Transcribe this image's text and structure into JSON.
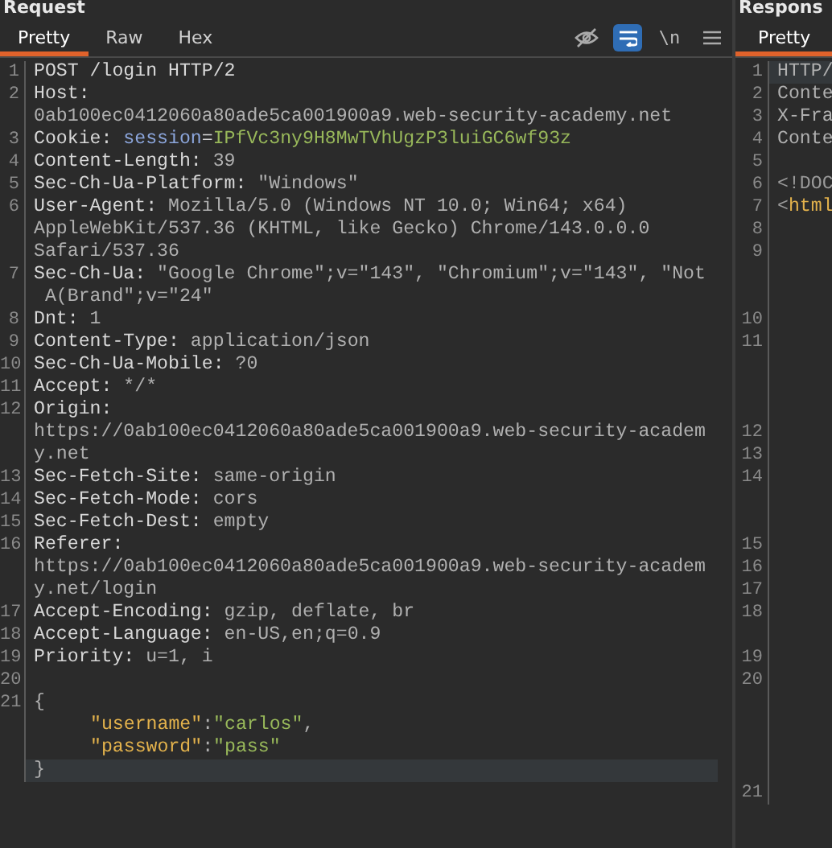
{
  "request": {
    "title": "Request",
    "tabs": [
      {
        "label": "Pretty",
        "selected": true
      },
      {
        "label": "Raw",
        "selected": false
      },
      {
        "label": "Hex",
        "selected": false
      }
    ],
    "toolbar": [
      {
        "kind": "hide",
        "on": false
      },
      {
        "kind": "wrap",
        "on": true
      },
      {
        "kind": "newline",
        "label": "\\n",
        "on": false
      },
      {
        "kind": "menu",
        "on": false
      }
    ],
    "rows": [
      {
        "number": "1",
        "highlighted": false,
        "segments": [
          {
            "text": "POST /login HTTP/2",
            "kind": "name"
          }
        ]
      },
      {
        "number": "2",
        "highlighted": false,
        "segments": [
          {
            "text": "Host:",
            "kind": "name"
          }
        ]
      },
      {
        "highlighted": false,
        "segments": [
          {
            "text": "0ab100ec0412060a80ade5ca001900a9.web-security-academy.net",
            "kind": "value"
          }
        ]
      },
      {
        "number": "3",
        "highlighted": false,
        "segments": [
          {
            "text": "Cookie: ",
            "kind": "name"
          },
          {
            "text": "session",
            "kind": "cookie"
          },
          {
            "text": "=",
            "kind": "name"
          },
          {
            "text": "IPfVc3ny9H8MwTVhUgzP3luiGC6wf93z",
            "kind": "token"
          }
        ]
      },
      {
        "number": "4",
        "highlighted": false,
        "segments": [
          {
            "text": "Content-Length:",
            "kind": "name"
          },
          {
            "text": " 39",
            "kind": "value"
          }
        ]
      },
      {
        "number": "5",
        "highlighted": false,
        "segments": [
          {
            "text": "Sec-Ch-Ua-Platform:",
            "kind": "name"
          },
          {
            "text": " \"Windows\"",
            "kind": "value"
          }
        ]
      },
      {
        "number": "6",
        "highlighted": false,
        "segments": [
          {
            "text": "User-Agent:",
            "kind": "name"
          },
          {
            "text": " Mozilla/5.0 (Windows NT 10.0; Win64; x64)",
            "kind": "value"
          }
        ]
      },
      {
        "highlighted": false,
        "segments": [
          {
            "text": "AppleWebKit/537.36 (KHTML, like Gecko) Chrome/143.0.0.0",
            "kind": "value"
          }
        ]
      },
      {
        "highlighted": false,
        "segments": [
          {
            "text": "Safari/537.36",
            "kind": "value"
          }
        ]
      },
      {
        "number": "7",
        "highlighted": false,
        "segments": [
          {
            "text": "Sec-Ch-Ua:",
            "kind": "name"
          },
          {
            "text": " \"Google Chrome\";v=\"143\", \"Chromium\";v=\"143\", \"Not",
            "kind": "value"
          }
        ]
      },
      {
        "highlighted": false,
        "segments": [
          {
            "text": " A(Brand\";v=\"24\"",
            "kind": "value"
          }
        ]
      },
      {
        "number": "8",
        "highlighted": false,
        "segments": [
          {
            "text": "Dnt:",
            "kind": "name"
          },
          {
            "text": " 1",
            "kind": "value"
          }
        ]
      },
      {
        "number": "9",
        "highlighted": false,
        "segments": [
          {
            "text": "Content-Type:",
            "kind": "name"
          },
          {
            "text": " application/json",
            "kind": "value"
          }
        ]
      },
      {
        "number": "10",
        "highlighted": false,
        "segments": [
          {
            "text": "Sec-Ch-Ua-Mobile:",
            "kind": "name"
          },
          {
            "text": " ?0",
            "kind": "value"
          }
        ]
      },
      {
        "number": "11",
        "highlighted": false,
        "segments": [
          {
            "text": "Accept:",
            "kind": "name"
          },
          {
            "text": " */*",
            "kind": "value"
          }
        ]
      },
      {
        "number": "12",
        "highlighted": false,
        "segments": [
          {
            "text": "Origin:",
            "kind": "name"
          }
        ]
      },
      {
        "highlighted": false,
        "segments": [
          {
            "text": "https://0ab100ec0412060a80ade5ca001900a9.web-security-academ",
            "kind": "value"
          }
        ]
      },
      {
        "highlighted": false,
        "segments": [
          {
            "text": "y.net",
            "kind": "value"
          }
        ]
      },
      {
        "number": "13",
        "highlighted": false,
        "segments": [
          {
            "text": "Sec-Fetch-Site:",
            "kind": "name"
          },
          {
            "text": " same-origin",
            "kind": "value"
          }
        ]
      },
      {
        "number": "14",
        "highlighted": false,
        "segments": [
          {
            "text": "Sec-Fetch-Mode:",
            "kind": "name"
          },
          {
            "text": " cors",
            "kind": "value"
          }
        ]
      },
      {
        "number": "15",
        "highlighted": false,
        "segments": [
          {
            "text": "Sec-Fetch-Dest:",
            "kind": "name"
          },
          {
            "text": " empty",
            "kind": "value"
          }
        ]
      },
      {
        "number": "16",
        "highlighted": false,
        "segments": [
          {
            "text": "Referer:",
            "kind": "name"
          }
        ]
      },
      {
        "highlighted": false,
        "segments": [
          {
            "text": "https://0ab100ec0412060a80ade5ca001900a9.web-security-academ",
            "kind": "value"
          }
        ]
      },
      {
        "highlighted": false,
        "segments": [
          {
            "text": "y.net/login",
            "kind": "value"
          }
        ]
      },
      {
        "number": "17",
        "highlighted": false,
        "segments": [
          {
            "text": "Accept-Encoding:",
            "kind": "name"
          },
          {
            "text": " gzip, deflate, br",
            "kind": "value"
          }
        ]
      },
      {
        "number": "18",
        "highlighted": false,
        "segments": [
          {
            "text": "Accept-Language:",
            "kind": "name"
          },
          {
            "text": " en-US,en;q=0.9",
            "kind": "value"
          }
        ]
      },
      {
        "number": "19",
        "highlighted": false,
        "segments": [
          {
            "text": "Priority:",
            "kind": "name"
          },
          {
            "text": " u=1, i",
            "kind": "value"
          }
        ]
      },
      {
        "number": "20",
        "highlighted": false,
        "segments": []
      },
      {
        "number": "21",
        "highlighted": false,
        "segments": [
          {
            "text": "{",
            "kind": "value"
          }
        ],
        "children": [
          {
            "highlighted": false,
            "segments": [
              {
                "text": "\"username\"",
                "kind": "json_key"
              },
              {
                "text": ":",
                "kind": "value"
              },
              {
                "text": "\"carlos\"",
                "kind": "json_string"
              },
              {
                "text": ",",
                "kind": "value"
              }
            ]
          },
          {
            "highlighted": false,
            "segments": [
              {
                "text": "\"password\"",
                "kind": "json_key"
              },
              {
                "text": ":",
                "kind": "value"
              },
              {
                "text": "\"pass\"",
                "kind": "json_string"
              }
            ]
          }
        ]
      },
      {
        "highlighted": true,
        "segments": [
          {
            "text": "}",
            "kind": "value"
          }
        ]
      }
    ]
  },
  "response": {
    "title": "Respons",
    "tabs": [
      {
        "label": "Pretty",
        "selected": true
      }
    ],
    "rows": [
      {
        "number": "1",
        "highlighted": true,
        "segments": [
          {
            "text": "HTTP/",
            "kind": "value"
          }
        ]
      },
      {
        "number": "2",
        "highlighted": false,
        "segments": [
          {
            "text": "Conte",
            "kind": "value"
          }
        ]
      },
      {
        "number": "3",
        "highlighted": false,
        "segments": [
          {
            "text": "X-Fra",
            "kind": "value"
          }
        ]
      },
      {
        "number": "4",
        "highlighted": false,
        "segments": [
          {
            "text": "Conte",
            "kind": "value"
          }
        ]
      },
      {
        "number": "5",
        "highlighted": false,
        "segments": []
      },
      {
        "number": "6",
        "highlighted": false,
        "segments": [
          {
            "text": "<!DOC",
            "kind": "dim"
          }
        ]
      },
      {
        "number": "7",
        "highlighted": false,
        "segments": [
          {
            "text": "<",
            "kind": "dim"
          },
          {
            "text": "html",
            "kind": "tag"
          }
        ]
      },
      {
        "number": "8",
        "highlighted": false,
        "segments": []
      },
      {
        "number": "9",
        "highlighted": false,
        "segments": []
      },
      {
        "highlighted": false,
        "segments": []
      },
      {
        "highlighted": false,
        "segments": []
      },
      {
        "number": "10",
        "highlighted": false,
        "segments": []
      },
      {
        "number": "11",
        "highlighted": false,
        "segments": []
      },
      {
        "highlighted": false,
        "segments": []
      },
      {
        "highlighted": false,
        "segments": []
      },
      {
        "highlighted": false,
        "segments": []
      },
      {
        "number": "12",
        "highlighted": false,
        "segments": []
      },
      {
        "number": "13",
        "highlighted": false,
        "segments": []
      },
      {
        "number": "14",
        "highlighted": false,
        "segments": []
      },
      {
        "highlighted": false,
        "segments": []
      },
      {
        "highlighted": false,
        "segments": []
      },
      {
        "number": "15",
        "highlighted": false,
        "segments": []
      },
      {
        "number": "16",
        "highlighted": false,
        "segments": []
      },
      {
        "number": "17",
        "highlighted": false,
        "segments": []
      },
      {
        "number": "18",
        "highlighted": false,
        "segments": []
      },
      {
        "highlighted": false,
        "segments": []
      },
      {
        "number": "19",
        "highlighted": false,
        "segments": []
      },
      {
        "number": "20",
        "highlighted": false,
        "segments": []
      },
      {
        "highlighted": false,
        "segments": []
      },
      {
        "highlighted": false,
        "segments": []
      },
      {
        "highlighted": false,
        "segments": []
      },
      {
        "highlighted": false,
        "segments": []
      },
      {
        "number": "21",
        "highlighted": false,
        "segments": []
      }
    ]
  }
}
